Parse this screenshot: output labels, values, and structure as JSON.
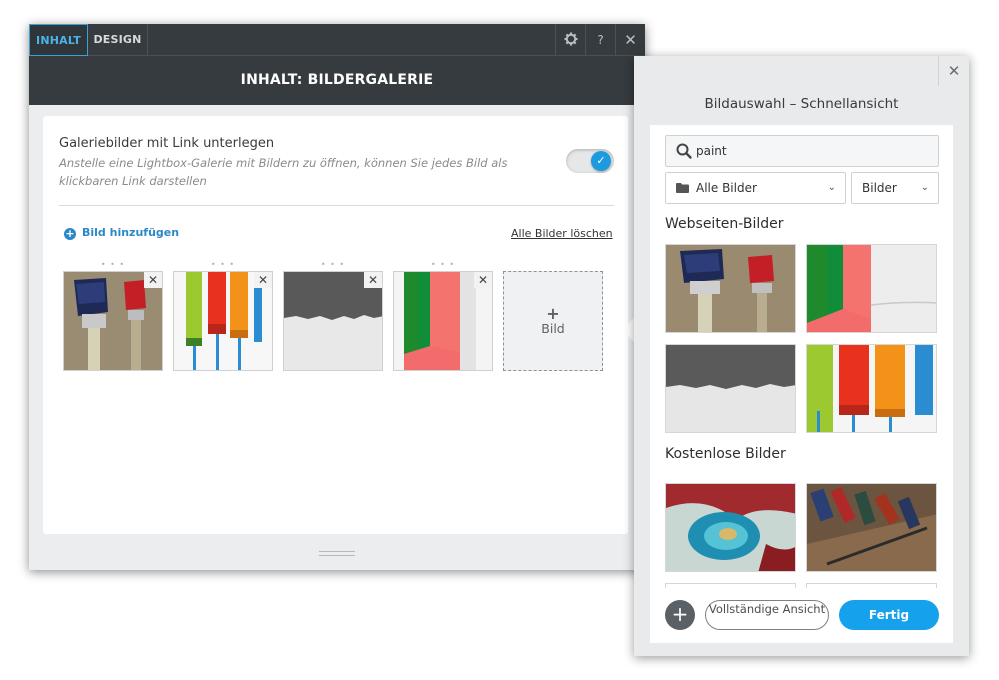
{
  "editor": {
    "tabs": [
      {
        "label": "INHALT",
        "active": true
      },
      {
        "label": "DESIGN",
        "active": false
      }
    ],
    "tools": {
      "help_label": "?",
      "close_label": "✕"
    },
    "header_title": "INHALT: BILDERGALERIE",
    "option": {
      "title": "Galeriebilder mit Link unterlegen",
      "description": "Anstelle eine Lightbox-Galerie mit Bildern zu öffnen, können Sie jedes Bild als klickbaren Link darstellen",
      "enabled": true
    },
    "add_image_label": "Bild hinzufügen",
    "delete_all_label": "Alle Bilder löschen",
    "gallery": [
      {
        "name": "brushes"
      },
      {
        "name": "rollers"
      },
      {
        "name": "grey-wall"
      },
      {
        "name": "stripes"
      }
    ],
    "new_tile_plus": "+",
    "new_tile_label": "Bild"
  },
  "picker": {
    "title": "Bildauswahl – Schnellansicht",
    "search": {
      "value": "paint"
    },
    "folder_select": "Alle Bilder",
    "type_select": "Bilder",
    "section_site": "Webseiten-Bilder",
    "section_free": "Kostenlose Bilder",
    "add_label": "+",
    "full_view_label": "Vollständige Ansicht",
    "done_label": "Fertig"
  },
  "colors": {
    "accent_blue": "#16a1ec",
    "dark_header": "#353b3f",
    "link_blue": "#2b88c6"
  }
}
